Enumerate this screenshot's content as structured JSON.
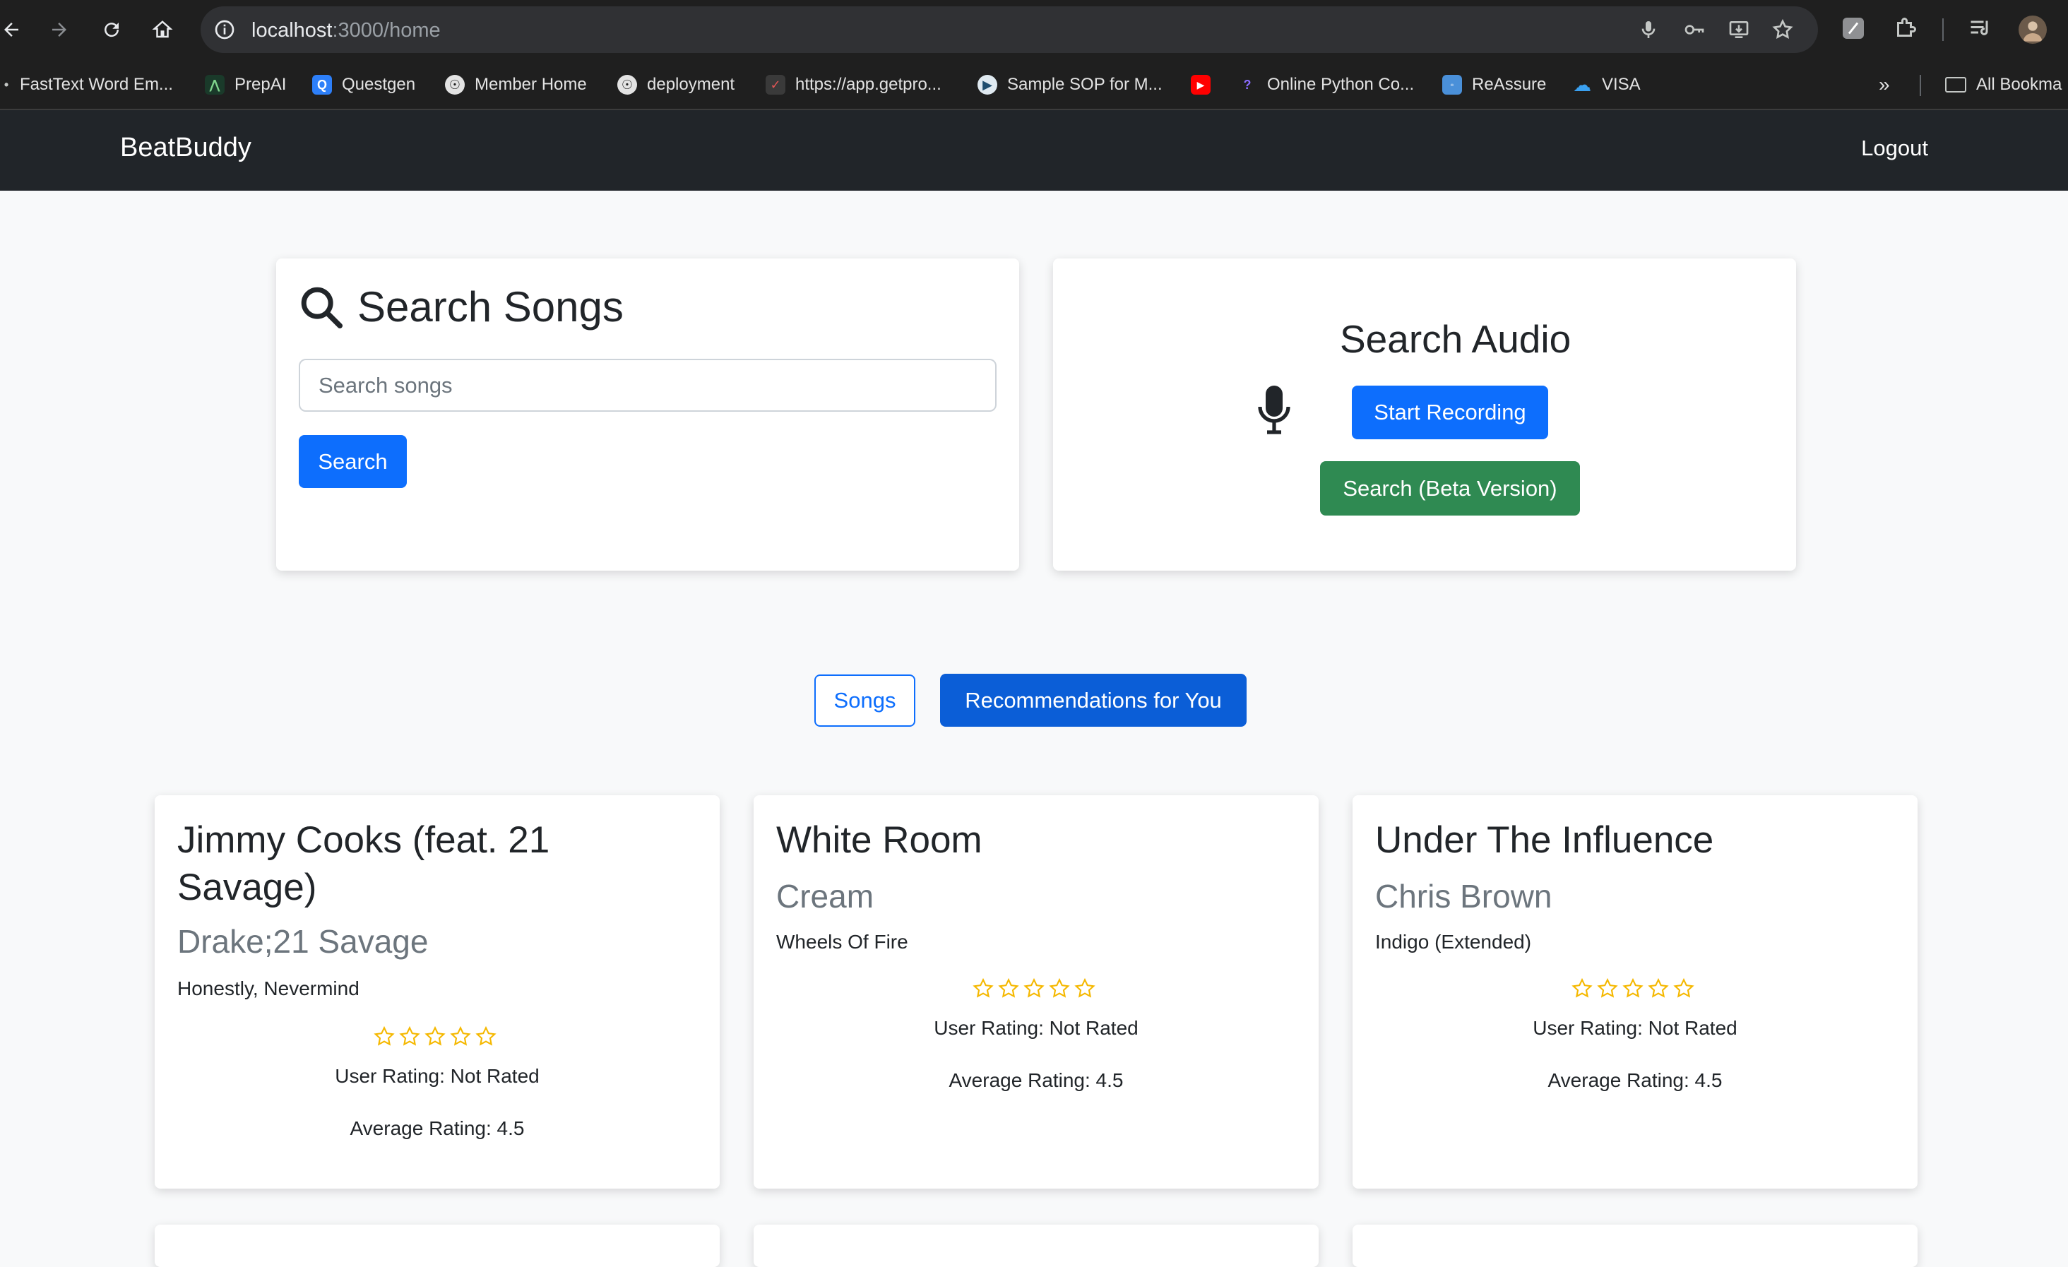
{
  "browser": {
    "url_host": "localhost",
    "url_path": ":3000/home",
    "bookmarks": [
      {
        "label": "FastText Word Em...",
        "icon": "bookmark-icon",
        "color": "#444444"
      },
      {
        "label": "PrepAI",
        "icon": "prepai-icon",
        "color": "#1a3a2a"
      },
      {
        "label": "Questgen",
        "icon": "questgen-icon",
        "color": "#2d7ff9"
      },
      {
        "label": "Member Home",
        "icon": "globe-icon",
        "color": "#555555"
      },
      {
        "label": "deployment",
        "icon": "globe-icon",
        "color": "#555555"
      },
      {
        "label": "https://app.getpro...",
        "icon": "check-icon",
        "color": "#3a3a3a"
      },
      {
        "label": "Sample SOP for M...",
        "icon": "sop-icon",
        "color": "#1f4d6e"
      },
      {
        "label": "",
        "icon": "youtube-icon",
        "color": "#ff0000"
      },
      {
        "label": "Online Python Co...",
        "icon": "python-icon",
        "color": "#3a2a6a"
      },
      {
        "label": "ReAssure",
        "icon": "reassure-icon",
        "color": "#4a90d9"
      },
      {
        "label": "VISA",
        "icon": "cloud-icon",
        "color": "#1a82d6"
      }
    ],
    "all_bookmarks": "All Bookma"
  },
  "navbar": {
    "brand": "BeatBuddy",
    "logout": "Logout"
  },
  "search_songs": {
    "title": "Search Songs",
    "placeholder": "Search songs",
    "button": "Search"
  },
  "search_audio": {
    "title": "Search Audio",
    "record_button": "Start Recording",
    "beta_button": "Search (Beta Version)"
  },
  "tabs": {
    "songs": "Songs",
    "recommendations": "Recommendations for You"
  },
  "songs": [
    {
      "title_line1": "Jimmy Cooks (feat. 21",
      "title_line2": "Savage)",
      "artist": "Drake;21 Savage",
      "album": "Honestly, Nevermind",
      "stars": 0,
      "user_rating": "User Rating: Not Rated",
      "average_rating": "Average Rating: 4.5"
    },
    {
      "title_line1": "White Room",
      "title_line2": "",
      "artist": "Cream",
      "album": "Wheels Of Fire",
      "stars": 0,
      "user_rating": "User Rating: Not Rated",
      "average_rating": "Average Rating: 4.5"
    },
    {
      "title_line1": "Under The Influence",
      "title_line2": "",
      "artist": "Chris Brown",
      "album": "Indigo (Extended)",
      "stars": 0,
      "user_rating": "User Rating: Not Rated",
      "average_rating": "Average Rating: 4.5"
    }
  ],
  "colors": {
    "primary": "#0d6efd",
    "success": "#198754",
    "star": "#f5b800",
    "navbar": "#212529"
  }
}
